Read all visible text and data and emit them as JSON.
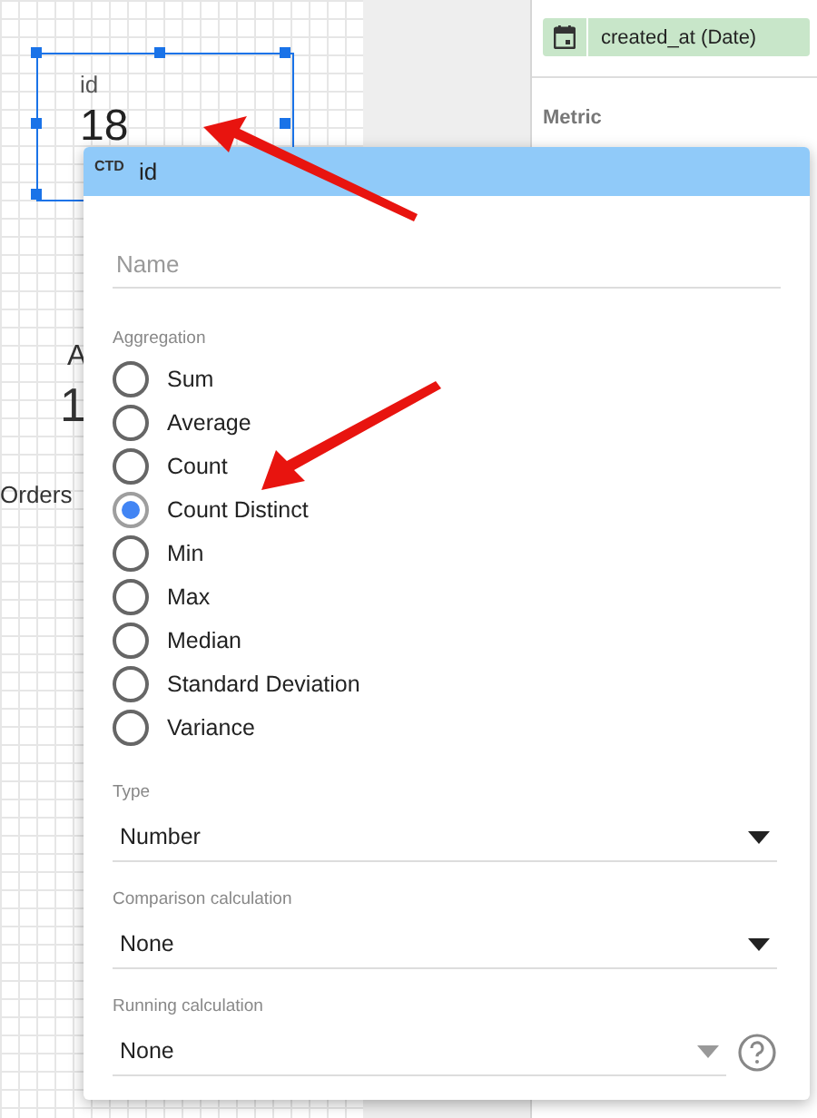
{
  "canvas": {
    "widget": {
      "label": "id",
      "value": "18",
      "selected": true
    },
    "partial_texts": [
      "A",
      "1",
      "Orders"
    ]
  },
  "side_panel": {
    "dimension_chip": {
      "label": "created_at (Date)"
    },
    "section_title": "Metric"
  },
  "field_editor": {
    "header": {
      "type_badge": "CTD",
      "field_name": "id"
    },
    "name_field": {
      "placeholder": "Name"
    },
    "aggregation": {
      "label": "Aggregation",
      "options": [
        {
          "label": "Sum",
          "selected": false
        },
        {
          "label": "Average",
          "selected": false
        },
        {
          "label": "Count",
          "selected": false
        },
        {
          "label": "Count Distinct",
          "selected": true
        },
        {
          "label": "Min",
          "selected": false
        },
        {
          "label": "Max",
          "selected": false
        },
        {
          "label": "Median",
          "selected": false
        },
        {
          "label": "Standard Deviation",
          "selected": false
        },
        {
          "label": "Variance",
          "selected": false
        }
      ]
    },
    "selects": [
      {
        "label": "Type",
        "value": "Number",
        "disabled": false,
        "help": false
      },
      {
        "label": "Comparison calculation",
        "value": "None",
        "disabled": false,
        "help": false
      },
      {
        "label": "Running calculation",
        "value": "None",
        "disabled": true,
        "help": true
      }
    ]
  }
}
